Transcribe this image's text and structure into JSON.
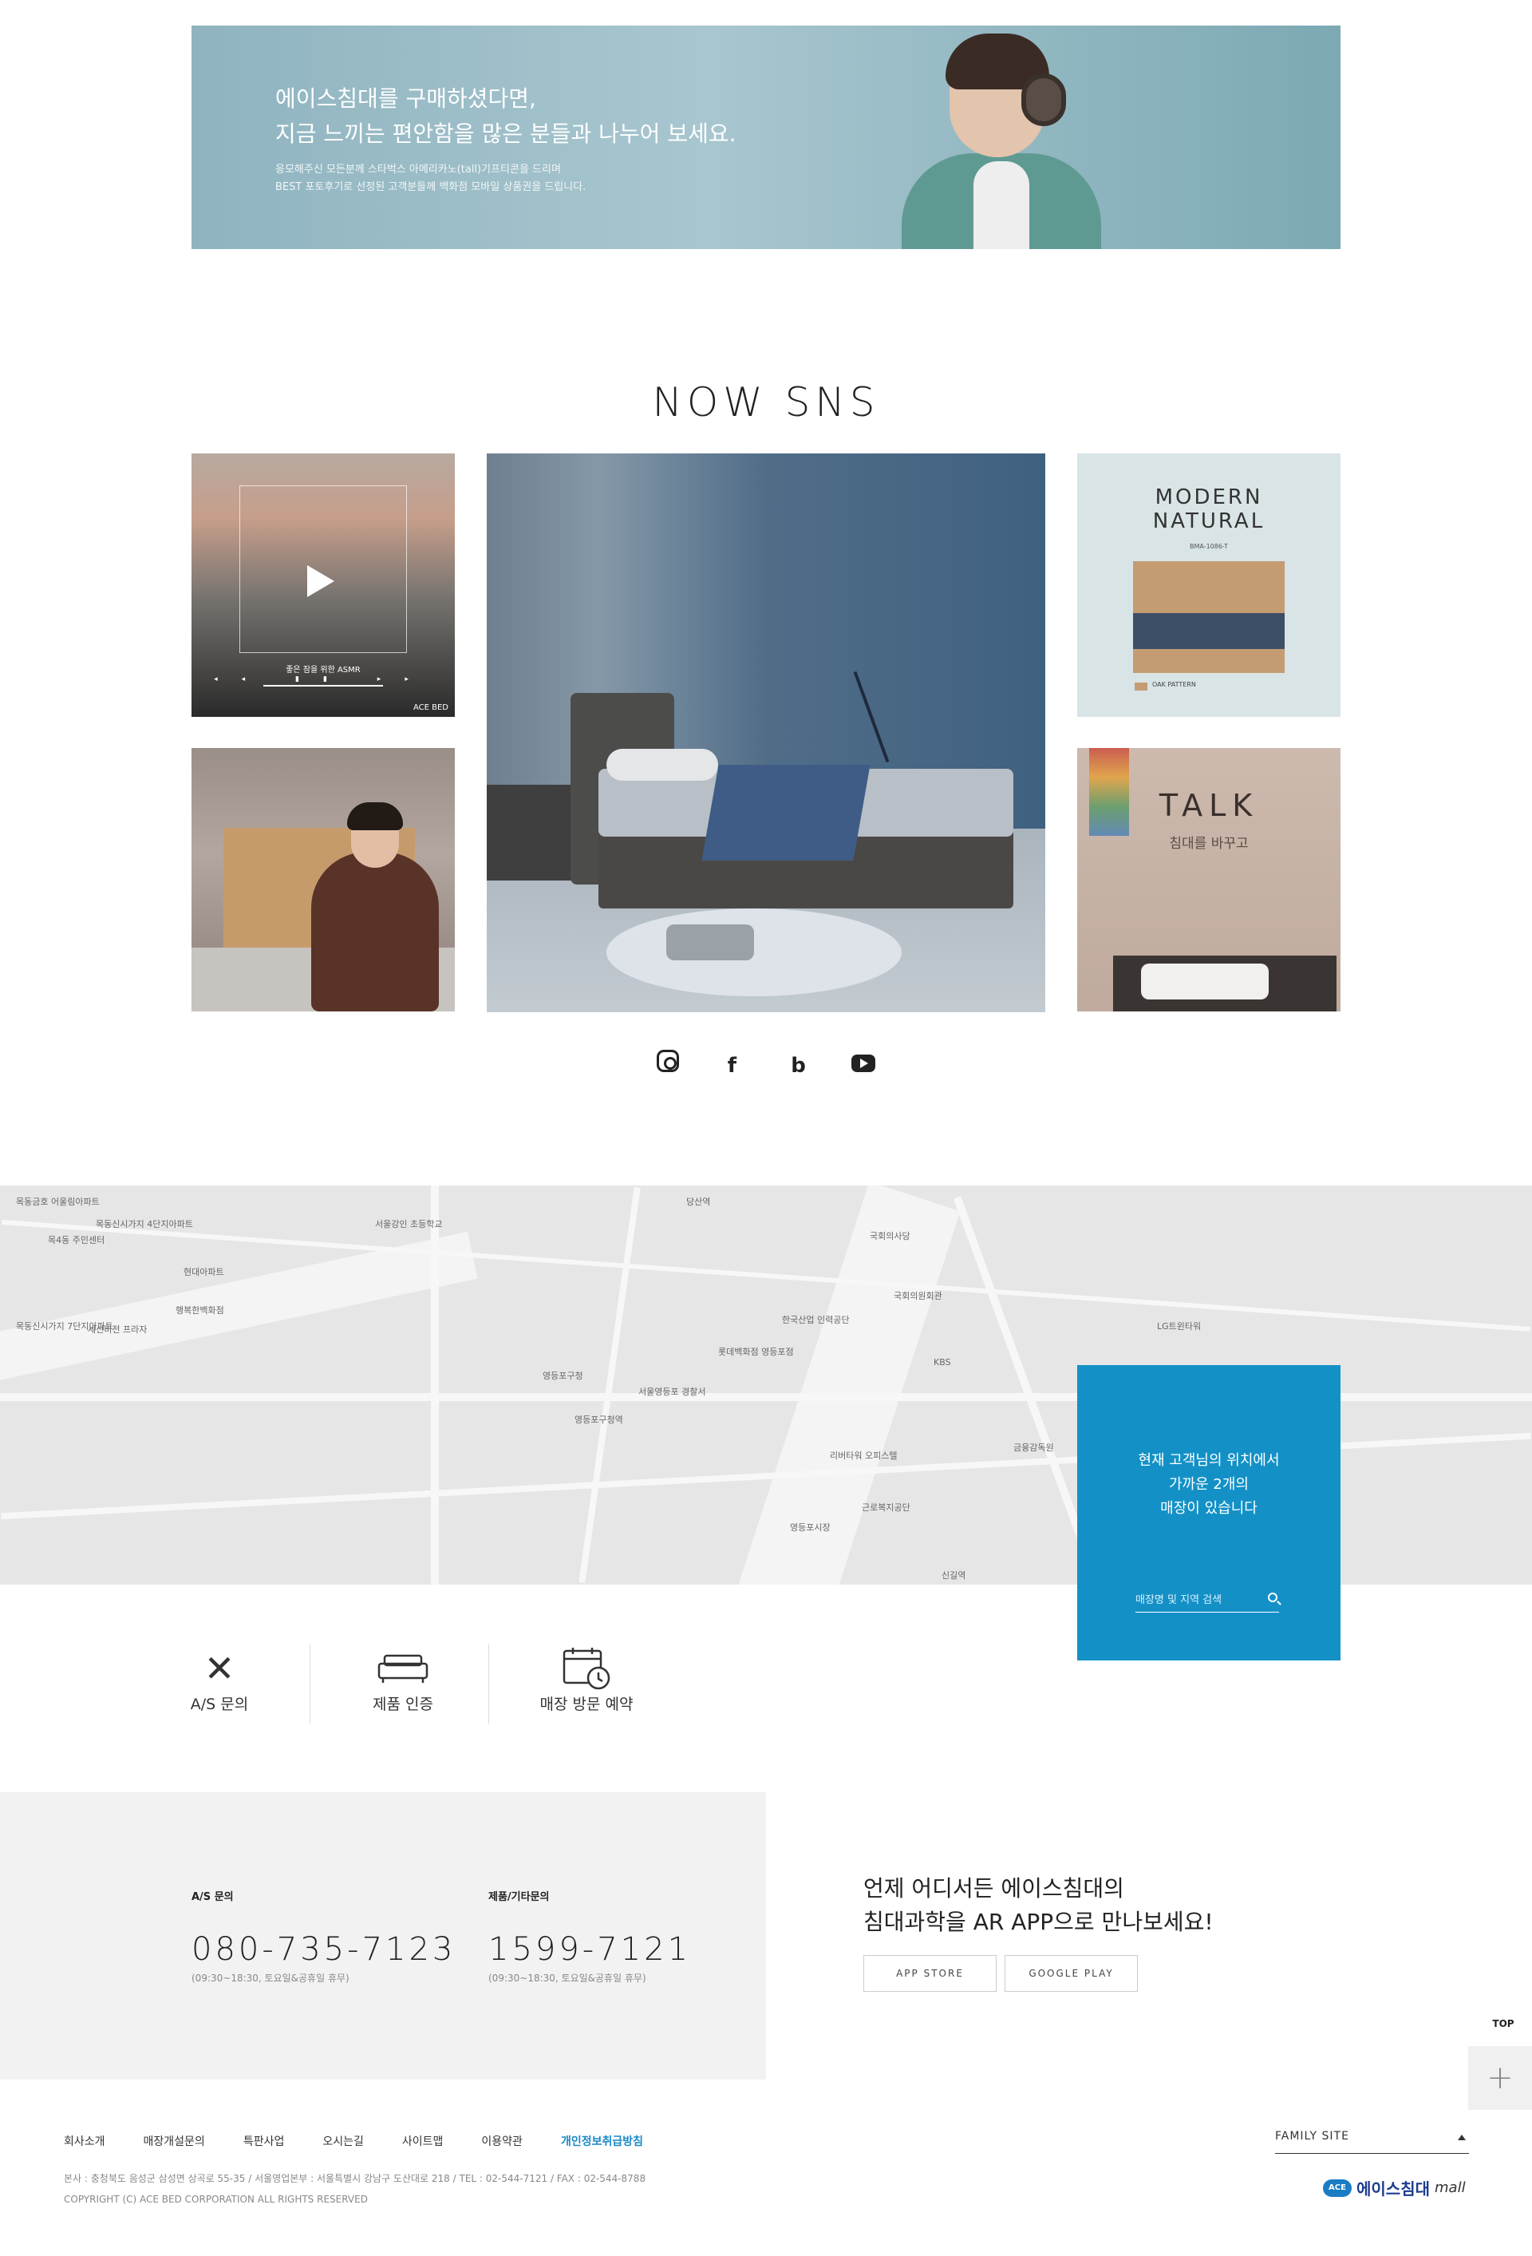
{
  "banner": {
    "title1": "에이스침대를 구매하셨다면,",
    "title2": "지금 느끼는 편안함을 많은 분들과 나누어 보세요.",
    "desc1": "응모해주신 모든분께 스타벅스 아메리카노(tall)기프티콘을 드리며",
    "desc2": "BEST 포토후기로 선정된 고객분들께 백화점 모바일 상품권을 드립니다."
  },
  "sns": {
    "title": "NOW SNS",
    "tile1": {
      "caption": "좋은 잠을 위한 ASMR",
      "controls": "◂◂ ▮▮ ▸▸",
      "brand": "ACE BED"
    },
    "tile4": {
      "title": "MODERN\nNATURAL",
      "model": "BMA-1086-T",
      "pattern": "OAK PATTERN"
    },
    "tile5": {
      "title": "TALK",
      "sub": "침대를 바꾸고"
    },
    "icons": [
      "instagram-icon",
      "facebook-icon",
      "blog-icon",
      "youtube-icon"
    ]
  },
  "store": {
    "msg1": "현재 고객님의 위치에서",
    "msg2": "가까운 2개의",
    "msg3": "매장이 있습니다",
    "placeholder": "매장명 및 지역 검색"
  },
  "map_labels": [
    "목동금호 어울림아파트",
    "목4동 주민센터",
    "목동신시가지 4단지아파트",
    "현대아파트",
    "행복한백화점",
    "목동신시가지 7단지아파트",
    "세신비전 프라자",
    "서울강인 초등학교",
    "영등포구청",
    "영등포구청역",
    "서울영등포 경찰서",
    "한국산업 인력공단",
    "롯데백화점 영등포점",
    "당산역",
    "국회의사당",
    "KBS",
    "국회의원회관",
    "LG트윈타워",
    "금융감독원",
    "근로복지공단",
    "리버타워 오피스텔",
    "신길역",
    "영등포시장"
  ],
  "quick": [
    {
      "label": "A/S 문의",
      "icon": "tools-icon"
    },
    {
      "label": "제품 인증",
      "icon": "bed-icon"
    },
    {
      "label": "매장 방문 예약",
      "icon": "calendar-icon"
    }
  ],
  "contact": {
    "as_label": "A/S 문의",
    "as_number": "080-735-7123",
    "as_hours": "(09:30~18:30, 토요일&공휴일 휴무)",
    "etc_label": "제품/기타문의",
    "etc_number": "1599-7121",
    "etc_hours": "(09:30~18:30, 토요일&공휴일 휴무)"
  },
  "app": {
    "line1": "언제 어디서든 에이스침대의",
    "line2": "침대과학을 AR APP으로 만나보세요!",
    "appstore": "APP STORE",
    "googleplay": "GOOGLE PLAY"
  },
  "float": {
    "top": "TOP",
    "plus": "+"
  },
  "footer": {
    "nav": [
      "회사소개",
      "매장개설문의",
      "특판사업",
      "오시는길",
      "사이트맵",
      "이용약관",
      "개인정보취급방침"
    ],
    "address": "본사 : 충청북도 음성군 삼성면 상곡로 55-35  / 서울영업본부 : 서울특별시 강남구 도산대로 218  / TEL : 02-544-7121 / FAX : 02-544-8788",
    "copyright": "COPYRIGHT (C) ACE BED CORPORATION ALL RIGHTS RESERVED",
    "family_site": "FAMILY SITE",
    "logo_badge": "ACE",
    "logo_name": "에이스침대",
    "logo_mall": "mall"
  },
  "colors": {
    "accent": "#1391c7",
    "footer_highlight": "#1a8ac7",
    "contact_bg": "#f2f2f2"
  }
}
